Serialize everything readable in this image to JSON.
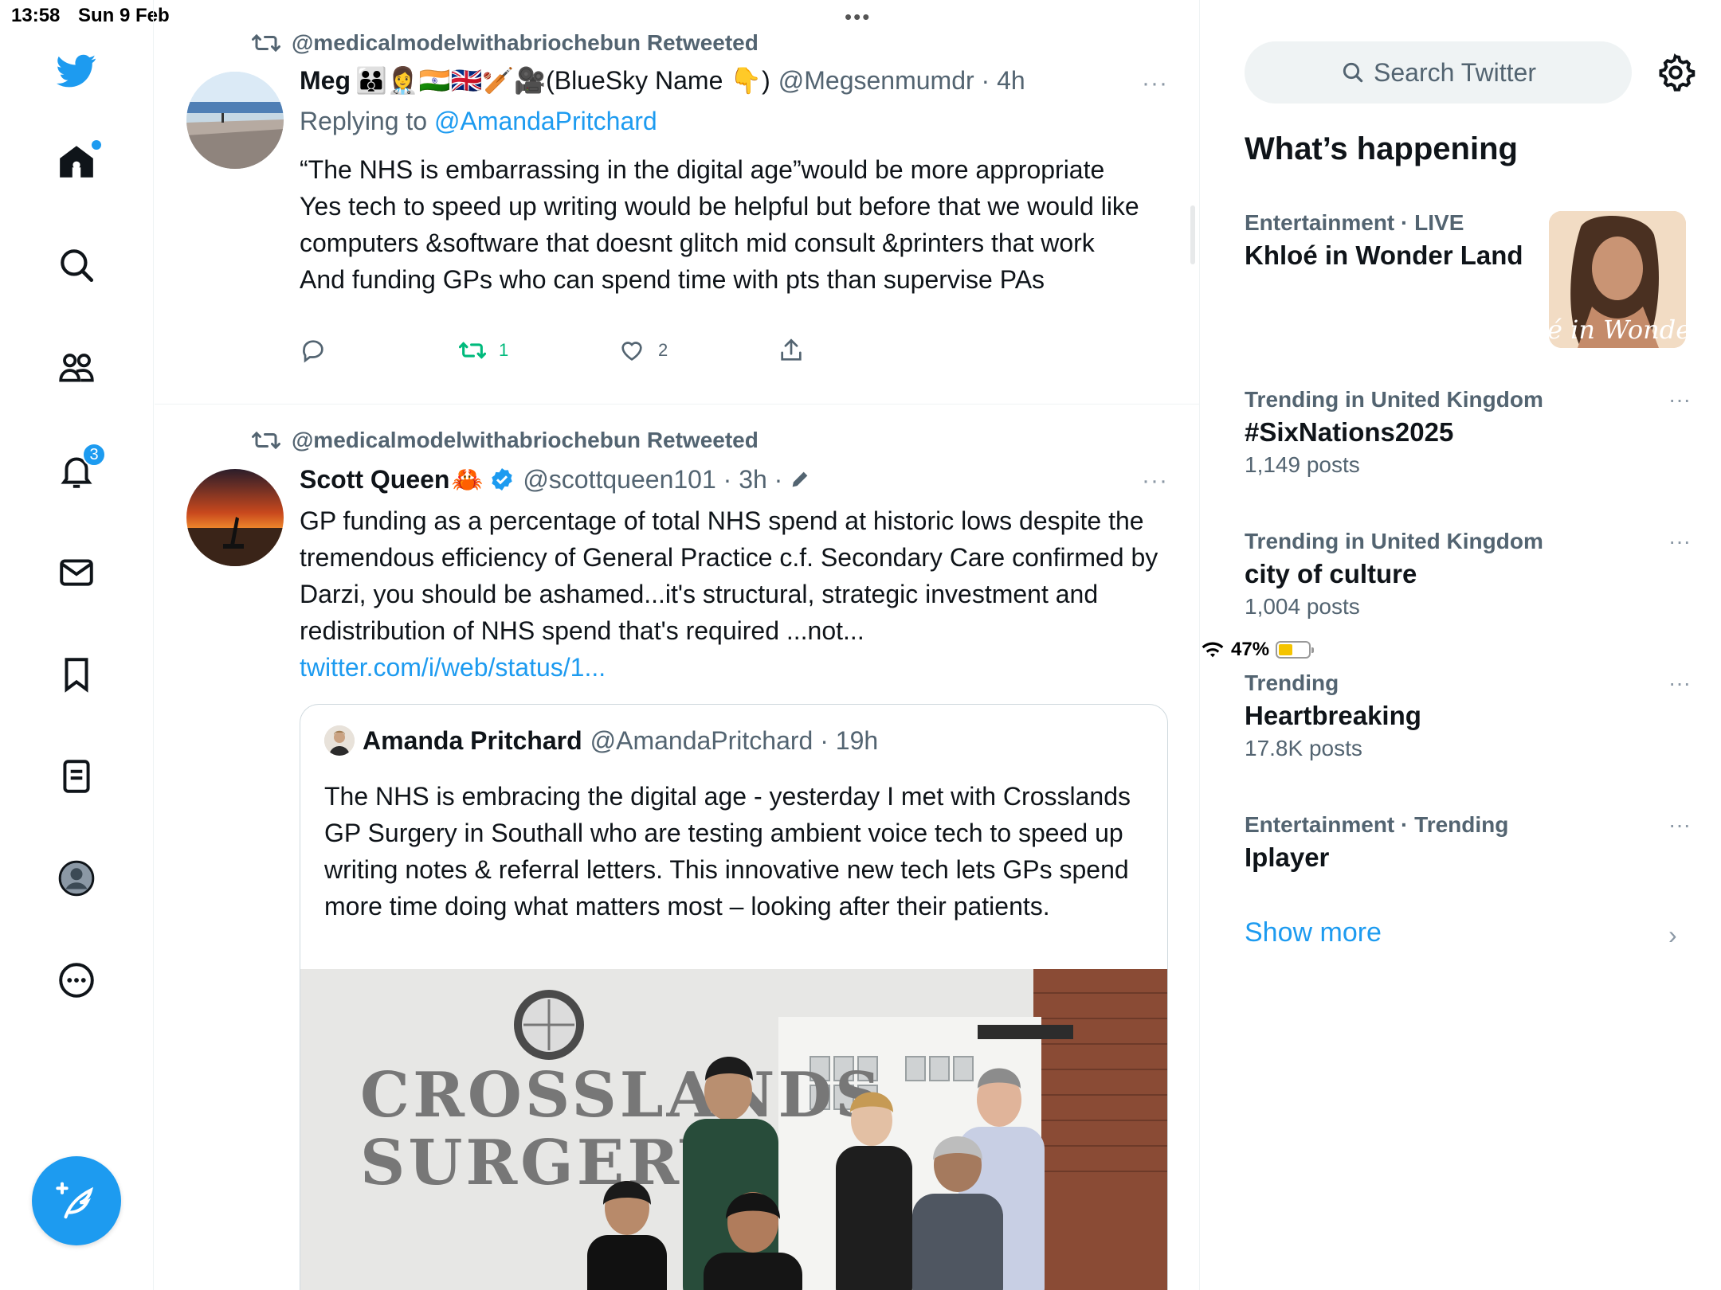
{
  "status": {
    "time": "13:58",
    "date": "Sun 9 Feb",
    "battery": "47%",
    "battery_level": 0.47
  },
  "nav": {
    "notifications_badge": "3"
  },
  "tweets": [
    {
      "retweet_line": "@medicalmodelwithabriochebun Retweeted",
      "name": "Meg",
      "name_emoji": "👪👩‍⚕️🇮🇳🇬🇧🏏🎥(BlueSky Name 👇)",
      "handle": "@Megsenmumdr · 4h",
      "replying_prefix": "Replying to",
      "replying_to": "@AmandaPritchard",
      "lines": [
        "“The NHS is embarrassing in the digital age”would be more appropriate",
        "Yes tech to speed up writing would be helpful but before that we would like computers &software that doesnt glitch mid consult &printers that work",
        "And funding GPs who can spend time with pts than supervise PAs"
      ],
      "retweets": "1",
      "likes": "2"
    },
    {
      "retweet_line": "@medicalmodelwithabriochebun Retweeted",
      "name": "Scott Queen",
      "name_emoji": "🦀",
      "handle": "@scottqueen101 · 3h ·",
      "text": "GP funding as a percentage of total NHS spend at historic lows despite the tremendous efficiency of General Practice c.f. Secondary Care confirmed by Darzi, you should be ashamed...it's structural, strategic investment and redistribution of NHS spend that's required ...not...",
      "link": "twitter.com/i/web/status/1...",
      "quote": {
        "name": "Amanda Pritchard",
        "handle": "@AmandaPritchard · 19h",
        "text": "The NHS is embracing the digital age - yesterday I met with Crosslands GP Surgery in Southall who are testing ambient voice tech to speed up writing notes & referral letters. This innovative new tech lets GPs spend more time doing what matters most – looking after their patients.",
        "image_sign_line1": "CROSSLANDS",
        "image_sign_line2": "SURGERY"
      }
    }
  ],
  "sidebar": {
    "search_placeholder": "Search Twitter",
    "heading": "What’s happening",
    "trends": [
      {
        "context": "Entertainment · LIVE",
        "title": "Khloé in Wonder Land",
        "count": "",
        "image_text": "é in Wonder L"
      },
      {
        "context": "Trending in United Kingdom",
        "title": "#SixNations2025",
        "count": "1,149 posts"
      },
      {
        "context": "Trending in United Kingdom",
        "title": "city of culture",
        "count": "1,004 posts"
      },
      {
        "context": "Trending",
        "title": "Heartbreaking",
        "count": "17.8K posts"
      },
      {
        "context": "Entertainment · Trending",
        "title": "Iplayer",
        "count": ""
      }
    ],
    "show_more": "Show more",
    "more_glyph": "···",
    "chevron": "›"
  },
  "colors": {
    "accent": "#1d9bf0",
    "retweet_green": "#00ba7c",
    "muted": "#536471"
  },
  "icons": [
    "twitter-bird-icon",
    "home-icon",
    "search-icon",
    "communities-icon",
    "bell-icon",
    "mail-icon",
    "bookmark-icon",
    "lists-icon",
    "profile-icon",
    "more-circle-icon",
    "compose-icon",
    "retweet-icon",
    "reply-icon",
    "like-icon",
    "share-icon",
    "verified-icon",
    "edit-icon",
    "gear-icon"
  ]
}
